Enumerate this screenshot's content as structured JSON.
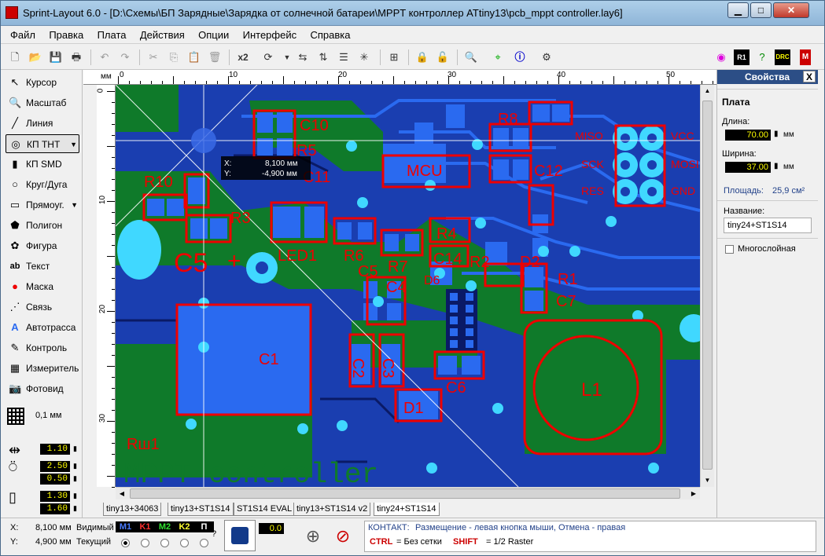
{
  "window": {
    "title": "Sprint-Layout 6.0 - [D:\\Схемы\\БП Зарядные\\Зарядка от солнечной батареи\\MPPT контроллер ATtiny13\\pcb_mppt controller.lay6]"
  },
  "menu": [
    "Файл",
    "Правка",
    "Плата",
    "Действия",
    "Опции",
    "Интерфейс",
    "Справка"
  ],
  "toolbar": {
    "mult_label": "x2",
    "right_badges": [
      "R1",
      "DRC"
    ]
  },
  "tools": [
    {
      "label": "Курсор",
      "icon": "cursor-icon"
    },
    {
      "label": "Масштаб",
      "icon": "zoom-icon"
    },
    {
      "label": "Линия",
      "icon": "line-icon"
    },
    {
      "label": "КП ТНТ",
      "icon": "tht-pad-icon"
    },
    {
      "label": "КП SMD",
      "icon": "smd-pad-icon"
    },
    {
      "label": "Круг/Дуга",
      "icon": "circle-icon"
    },
    {
      "label": "Прямоуг.",
      "icon": "rectangle-icon"
    },
    {
      "label": "Полигон",
      "icon": "polygon-icon"
    },
    {
      "label": "Фигура",
      "icon": "figure-icon"
    },
    {
      "label": "Текст",
      "icon": "text-icon"
    },
    {
      "label": "Маска",
      "icon": "mask-icon"
    },
    {
      "label": "Связь",
      "icon": "connection-icon"
    },
    {
      "label": "Автотрасса",
      "icon": "autoroute-icon"
    },
    {
      "label": "Контроль",
      "icon": "control-icon"
    },
    {
      "label": "Измеритель",
      "icon": "measure-icon"
    },
    {
      "label": "Фотовид",
      "icon": "photo-icon"
    }
  ],
  "grid": {
    "label": "0,1 мм"
  },
  "spinners": {
    "track": "1.10",
    "pad_outer": "2.50",
    "pad_inner": "0.50",
    "smd_w": "1.30",
    "smd_h": "1.60"
  },
  "ruler": {
    "unit": "мм",
    "top_ticks": [
      "0",
      "10",
      "20",
      "30",
      "40",
      "50"
    ],
    "left_ticks": [
      "0",
      "10",
      "20",
      "30"
    ]
  },
  "cursor_tooltip": {
    "x_label": "X:",
    "x_value": "8,100 мм",
    "y_label": "Y:",
    "y_value": "-4,900 мм"
  },
  "pcb": {
    "labels": [
      "C10",
      "R5",
      "C11",
      "MCU",
      "R8",
      "C12",
      "R10",
      "R3",
      "LED1",
      "R6",
      "R7",
      "R4",
      "C14",
      "R2",
      "D2",
      "C5",
      "C4",
      "D6",
      "R1",
      "C7",
      "C1",
      "C2",
      "C3",
      "C6",
      "L1",
      "D1",
      "Rш1",
      "C5"
    ],
    "small_labels": [
      "MISO",
      "VCC",
      "SCK",
      "MOSI",
      "RES",
      "GND"
    ],
    "big_text": "MPPT controller",
    "big_label": "C5",
    "plus_sign": "+"
  },
  "tabs": [
    "tiny13+34063",
    "tiny13+ST1S14",
    "ST1S14 EVAL",
    "tiny13+ST1S14 v2",
    "tiny24+ST1S14"
  ],
  "props": {
    "header": "Свойства",
    "close": "X",
    "section": "Плата",
    "length_label": "Длина:",
    "length_value": "70.00",
    "length_unit": "мм",
    "width_label": "Ширина:",
    "width_value": "37.00",
    "width_unit": "мм",
    "area_label": "Площадь:",
    "area_value": "25,9 см²",
    "name_label": "Название:",
    "name_value": "tiny24+ST1S14",
    "multilayer_label": "Многослойная"
  },
  "status": {
    "x_label": "X:",
    "x_value": "8,100 мм",
    "y_label": "Y:",
    "y_value": "4,900 мм",
    "visible_label": "Видимый",
    "current_label": "Текущий",
    "layers": [
      {
        "name": "M1",
        "color": "#4a7cff"
      },
      {
        "name": "K1",
        "color": "#ff3030"
      },
      {
        "name": "M2",
        "color": "#30e030"
      },
      {
        "name": "K2",
        "color": "#ffff30"
      },
      {
        "name": "П",
        "color": "#ffffff"
      }
    ],
    "question": "?",
    "zoom_value": "0.0",
    "hint1_prefix": "КОНТАКТ:",
    "hint1_text": "Размещение - левая кнопка мыши, Отмена - правая",
    "hint2_key1": "CTRL",
    "hint2_text1": "= Без сетки",
    "hint2_key2": "SHIFT",
    "hint2_text2": "= 1/2 Raster"
  }
}
